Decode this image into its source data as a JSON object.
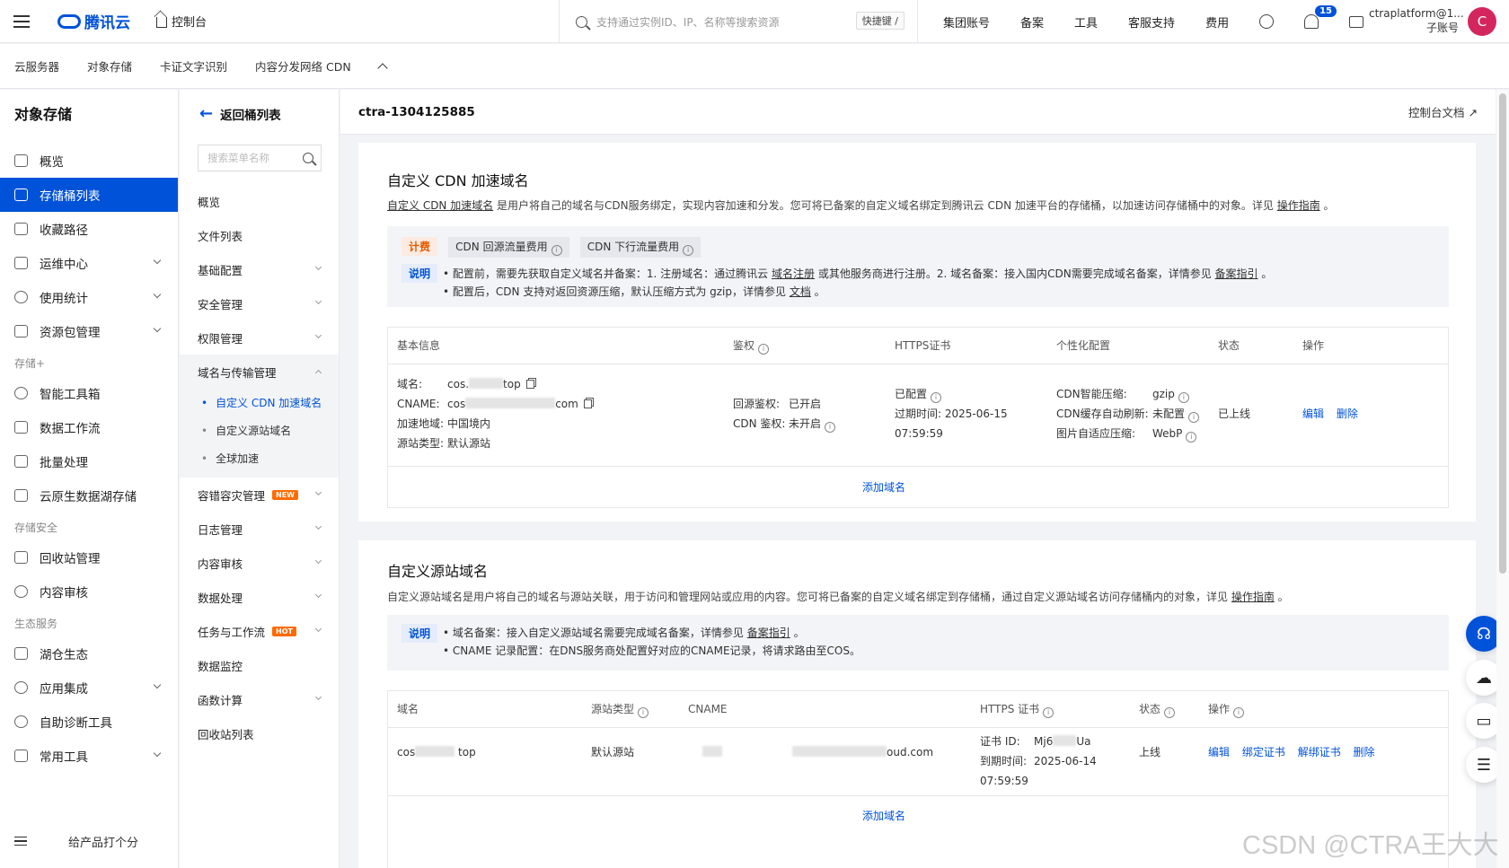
{
  "topbar": {
    "brand": "腾讯云",
    "console": "控制台",
    "search_placeholder": "支持通过实例ID、IP、名称等搜索资源",
    "shortcut": "快捷键 /",
    "links": [
      "集团账号",
      "备案",
      "工具",
      "客服支持",
      "费用"
    ],
    "notification_count": "15",
    "username": "ctraplatform@1...",
    "user_role": "子账号",
    "avatar_letter": "C"
  },
  "subnav": [
    "云服务器",
    "对象存储",
    "卡证文字识别",
    "内容分发网络 CDN"
  ],
  "sidebar": {
    "title": "对象存储",
    "items": [
      {
        "label": "概览"
      },
      {
        "label": "存储桶列表"
      },
      {
        "label": "收藏路径"
      },
      {
        "label": "运维中心"
      },
      {
        "label": "使用统计"
      },
      {
        "label": "资源包管理"
      }
    ],
    "group_storage_plus": "存储+",
    "storage_items": [
      "智能工具箱",
      "数据工作流",
      "批量处理",
      "云原生数据湖存储"
    ],
    "group_security": "存储安全",
    "security_items": [
      "回收站管理",
      "内容审核"
    ],
    "group_eco": "生态服务",
    "eco_items": [
      "湖仓生态",
      "应用集成",
      "自助诊断工具",
      "常用工具"
    ],
    "feedback": "给产品打个分"
  },
  "sidebar2": {
    "back": "返回桶列表",
    "search_placeholder": "搜索菜单名称",
    "items": [
      "概览",
      "文件列表",
      "基础配置",
      "安全管理",
      "权限管理",
      "域名与传输管理"
    ],
    "sub_items": [
      "自定义 CDN 加速域名",
      "自定义源站域名",
      "全球加速"
    ],
    "items_after": [
      "容错容灾管理",
      "日志管理",
      "内容审核",
      "数据处理",
      "任务与工作流",
      "数据监控",
      "函数计算",
      "回收站列表"
    ],
    "tag_new": "NEW",
    "tag_hot": "HOT"
  },
  "bucket": {
    "name": "ctra-1304125885",
    "docs": "控制台文档"
  },
  "cdn_section": {
    "title": "自定义 CDN 加速域名",
    "desc_link": "自定义 CDN 加速域名",
    "desc": " 是用户将自己的域名与CDN服务绑定，实现内容加速和分发。您可将已备案的自定义域名绑定到腾讯云 CDN 加速平台的存储桶，以加速访问存储桶中的对象。详见 ",
    "desc_guide": "操作指南",
    "desc_end": " 。",
    "fee_label": "计费",
    "fee_items": [
      "CDN 回源流量费用",
      "CDN 下行流量费用"
    ],
    "note_label": "说明",
    "note1_a": "配置前，需要先获取自定义域名并备案：1. 注册域名：通过腾讯云 ",
    "note1_link1": "域名注册",
    "note1_b": " 或其他服务商进行注册。2. 域名备案：接入国内CDN需要完成域名备案，详情参见 ",
    "note1_link2": "备案指引",
    "note1_c": " 。",
    "note2_a": "配置后，CDN 支持对返回资源压缩，默认压缩方式为 gzip，详情参见 ",
    "note2_link": "文档",
    "note2_b": " 。",
    "headers": [
      "基本信息",
      "鉴权",
      "HTTPS证书",
      "个性化配置",
      "状态",
      "操作"
    ],
    "row": {
      "domain_label": "域名:",
      "domain_a": "cos.",
      "domain_b": "top",
      "cname_label": "CNAME:",
      "cname_a": "cos",
      "cname_b": "com",
      "region_label": "加速地域:",
      "region": "中国境内",
      "origin_label": "源站类型:",
      "origin": "默认源站",
      "auth1_label": "回源鉴权:",
      "auth1": "已开启",
      "auth2_label": "CDN 鉴权:",
      "auth2": "未开启",
      "https_status": "已配置",
      "expire_label": "过期时间:",
      "expire_date": "2025-06-15",
      "expire_time": "07:59:59",
      "p1_label": "CDN智能压缩:",
      "p1": "gzip",
      "p2_label": "CDN缓存自动刷新:",
      "p2": "未配置",
      "p3_label": "图片自适应压缩:",
      "p3": "WebP",
      "status": "已上线",
      "edit": "编辑",
      "delete": "删除"
    },
    "add": "添加域名"
  },
  "origin_section": {
    "title": "自定义源站域名",
    "desc": "自定义源站域名是用户将自己的域名与源站关联，用于访问和管理网站或应用的内容。您可将已备案的自定义域名绑定到存储桶，通过自定义源站域名访问存储桶内的对象，详见 ",
    "desc_guide": "操作指南",
    "desc_end": " 。",
    "note_label": "说明",
    "note1_a": "域名备案：接入自定义源站域名需要完成域名备案，详情参见 ",
    "note1_link": "备案指引",
    "note1_b": " 。",
    "note2": "CNAME 记录配置：在DNS服务商处配置好对应的CNAME记录，将请求路由至COS。",
    "headers": [
      "域名",
      "源站类型",
      "CNAME",
      "HTTPS 证书",
      "状态",
      "操作"
    ],
    "row": {
      "domain_a": "cos",
      "domain_b": "top",
      "origin": "默认源站",
      "cname_end": "oud.com",
      "cert_label": "证书 ID:",
      "cert_a": "Mj6",
      "cert_b": "Ua",
      "expire_label": "到期时间:",
      "expire_date": "2025-06-14",
      "expire_time": "07:59:59",
      "status": "上线",
      "actions": [
        "编辑",
        "绑定证书",
        "解绑证书",
        "删除"
      ]
    },
    "add": "添加域名"
  },
  "watermark": "CSDN @CTRA王大大"
}
